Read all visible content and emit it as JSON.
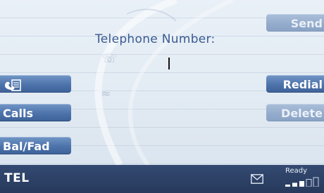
{
  "screen": {
    "heading": "Telephone Number:",
    "number_value": ""
  },
  "buttons": {
    "phonebook_icon": "phonebook-icon",
    "calls": "Calls",
    "balance_fader": "Bal/Fad",
    "send": "Send",
    "redial": "Redial",
    "delete": "Delete"
  },
  "status": {
    "mode": "TEL",
    "ready": "Ready",
    "signal_bars_filled": 3,
    "signal_bars_total": 5,
    "message_icon": "envelope-icon"
  },
  "colors": {
    "button": "#4d73ab",
    "button_disabled": "#93abcb",
    "heading_text": "#3a5a90",
    "statusbar": "#2c3f64"
  }
}
